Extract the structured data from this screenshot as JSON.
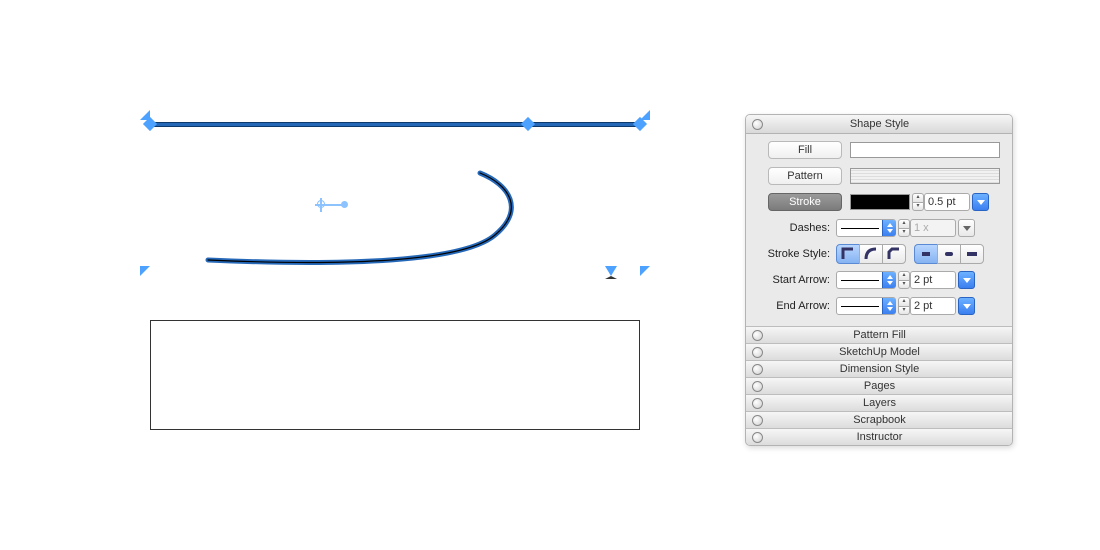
{
  "panel": {
    "header": "Shape Style",
    "fill": {
      "label": "Fill"
    },
    "pattern": {
      "label": "Pattern"
    },
    "stroke": {
      "label": "Stroke",
      "weight": "0.5 pt"
    },
    "dashes": {
      "label": "Dashes:",
      "scale": "1 x"
    },
    "stroke_style": {
      "label": "Stroke Style:"
    },
    "start_arrow": {
      "label": "Start Arrow:",
      "size": "2 pt"
    },
    "end_arrow": {
      "label": "End Arrow:",
      "size": "2 pt"
    }
  },
  "accordion": {
    "pattern_fill": "Pattern Fill",
    "sketchup": "SketchUp Model",
    "dimension": "Dimension Style",
    "pages": "Pages",
    "layers": "Layers",
    "scrapbook": "Scrapbook",
    "instructor": "Instructor"
  }
}
